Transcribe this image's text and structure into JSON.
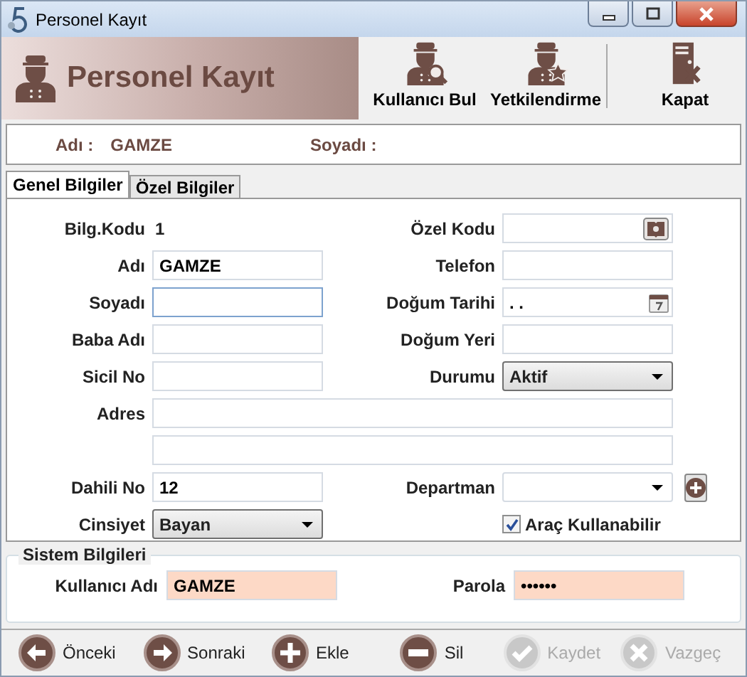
{
  "window": {
    "title": "Personel Kayıt"
  },
  "header": {
    "title": "Personel Kayıt",
    "tools": [
      {
        "label": "Kullanıcı Bul"
      },
      {
        "label": "Yetkilendirme"
      },
      {
        "label": "Kapat"
      }
    ]
  },
  "summary": [
    {
      "label": "Adı :",
      "value": "GAMZE"
    },
    {
      "label": "Soyadı :"
    }
  ],
  "tabs": [
    {
      "label": "Genel Bilgiler",
      "selected": true
    },
    {
      "label": "Özel Bilgiler",
      "selected": false
    }
  ],
  "rows": [
    {
      "left": {
        "kind": "static",
        "label": "Bilg.Kodu",
        "value": "1"
      },
      "right": {
        "kind": "lookup",
        "label": "Özel Kodu"
      }
    },
    {
      "left": {
        "kind": "text",
        "label": "Adı",
        "value": "GAMZE",
        "focused": false
      },
      "right": {
        "kind": "text",
        "label": "Telefon",
        "focused": false
      }
    },
    {
      "left": {
        "kind": "text",
        "label": "Soyadı",
        "focused": true
      },
      "right": {
        "kind": "date",
        "label": "Doğum Tarihi",
        "value": " . ."
      }
    },
    {
      "left": {
        "kind": "text",
        "label": "Baba Adı",
        "focused": false
      },
      "right": {
        "kind": "text",
        "label": "Doğum Yeri",
        "focused": false
      }
    },
    {
      "left": {
        "kind": "text",
        "label": "Sicil No",
        "focused": false
      },
      "right": {
        "kind": "combo",
        "label": "Durumu",
        "value": "Aktif",
        "flat": false
      }
    },
    {
      "wide": {
        "label": "Adres"
      }
    },
    {
      "left": {
        "kind": "text",
        "label": "Dahili No",
        "value": "12",
        "focused": false
      },
      "right": {
        "kind": "combo",
        "label": "Departman",
        "flat": true,
        "add_button": true
      }
    },
    {
      "left": {
        "kind": "combo",
        "label": "Cinsiyet",
        "value": "Bayan",
        "flat": false
      },
      "right": {
        "kind": "checkbox",
        "label": "Araç Kullanabilir",
        "checked": true
      }
    }
  ],
  "system": {
    "title": "Sistem Bilgileri",
    "fields": [
      {
        "label": "Kullanıcı Adı",
        "value": "GAMZE"
      },
      {
        "label": "Parola",
        "value": "••••••"
      }
    ]
  },
  "actions": [
    {
      "label": "Önceki",
      "disabled": false
    },
    {
      "label": "Sonraki",
      "disabled": false
    },
    {
      "label": "Ekle",
      "disabled": false
    },
    {
      "label": "Sil",
      "disabled": false
    },
    {
      "label": "Kaydet",
      "disabled": true
    },
    {
      "label": "Vazgeç",
      "disabled": true
    }
  ]
}
